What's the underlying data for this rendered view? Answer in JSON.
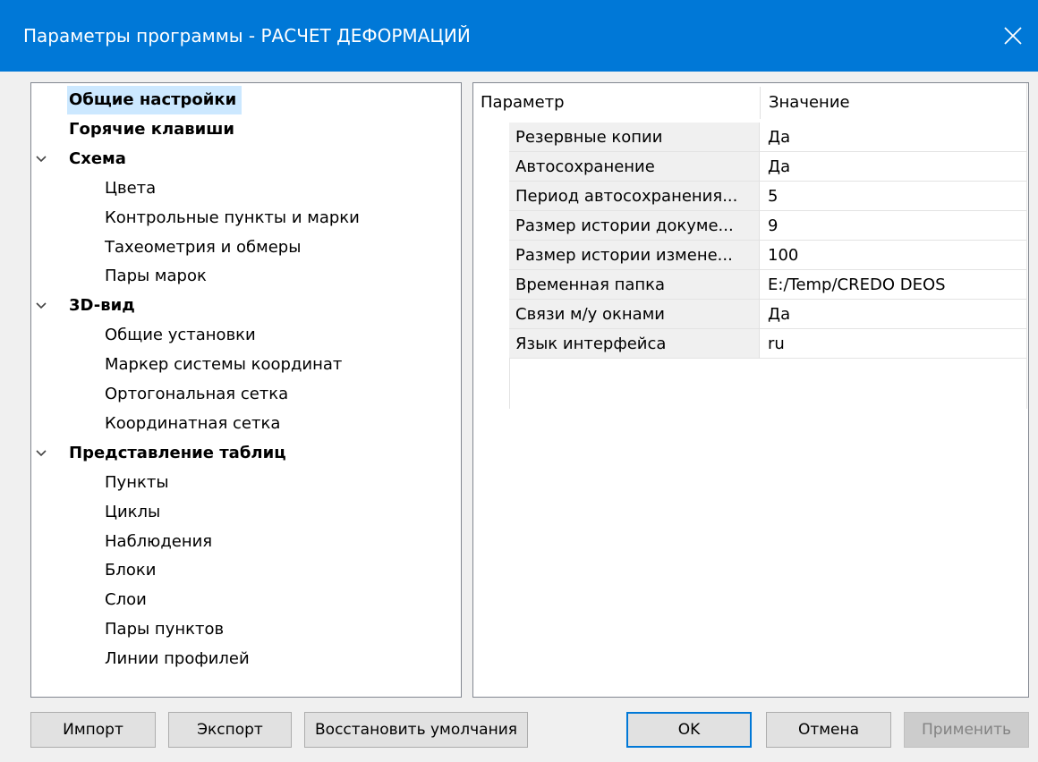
{
  "window": {
    "title": "Параметры программы - РАСЧЕТ ДЕФОРМАЦИЙ",
    "close_icon": "close-icon"
  },
  "tree": {
    "items": [
      {
        "label": "Общие настройки",
        "level": 0,
        "bold": true,
        "selected": true
      },
      {
        "label": "Горячие клавиши",
        "level": 0,
        "bold": true
      },
      {
        "label": "Схема",
        "level": 0,
        "bold": true,
        "expanded": true
      },
      {
        "label": "Цвета",
        "level": 1
      },
      {
        "label": "Контрольные пункты и марки",
        "level": 1
      },
      {
        "label": "Тахеометрия и обмеры",
        "level": 1
      },
      {
        "label": "Пары марок",
        "level": 1
      },
      {
        "label": "3D-вид",
        "level": 0,
        "bold": true,
        "expanded": true
      },
      {
        "label": "Общие установки",
        "level": 1
      },
      {
        "label": "Маркер системы координат",
        "level": 1
      },
      {
        "label": "Ортогональная сетка",
        "level": 1
      },
      {
        "label": "Координатная сетка",
        "level": 1
      },
      {
        "label": "Представление таблиц",
        "level": 0,
        "bold": true,
        "expanded": true
      },
      {
        "label": "Пункты",
        "level": 1
      },
      {
        "label": "Циклы",
        "level": 1
      },
      {
        "label": "Наблюдения",
        "level": 1
      },
      {
        "label": "Блоки",
        "level": 1
      },
      {
        "label": "Слои",
        "level": 1
      },
      {
        "label": "Пары пунктов",
        "level": 1
      },
      {
        "label": "Линии профилей",
        "level": 1
      }
    ]
  },
  "grid": {
    "header_param": "Параметр",
    "header_value": "Значение",
    "rows": [
      {
        "name": "Резервные копии",
        "value": "Да"
      },
      {
        "name": "Автосохранение",
        "value": "Да"
      },
      {
        "name": "Период автосохранения...",
        "value": "5"
      },
      {
        "name": "Размер истории докуме...",
        "value": "9"
      },
      {
        "name": "Размер истории измене...",
        "value": "100"
      },
      {
        "name": "Временная папка",
        "value": "E:/Temp/CREDO DEOS"
      },
      {
        "name": "Связи м/у окнами",
        "value": "Да"
      },
      {
        "name": "Язык интерфейса",
        "value": "ru"
      }
    ]
  },
  "buttons": {
    "import": "Импорт",
    "export": "Экспорт",
    "restore": "Восстановить умолчания",
    "ok": "OK",
    "cancel": "Отмена",
    "apply": "Применить"
  },
  "colors": {
    "titlebar": "#0078d7",
    "selection": "#cce8ff",
    "default_button_border": "#0078d7"
  }
}
